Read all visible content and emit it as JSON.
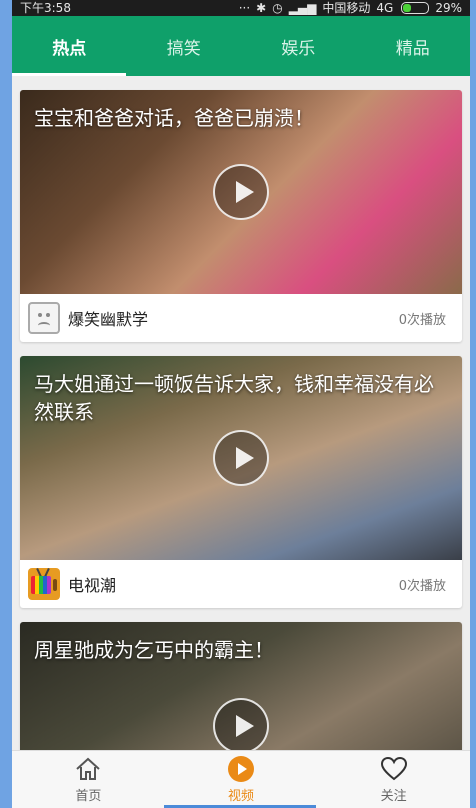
{
  "status": {
    "time": "下午3:58",
    "carrier": "中国移动",
    "network": "4G",
    "battery": "29%",
    "icons": [
      "dots-icon",
      "bluetooth-icon",
      "alarm-icon",
      "signal-icon",
      "battery-icon"
    ]
  },
  "tabs": [
    {
      "label": "热点",
      "active": true
    },
    {
      "label": "搞笑",
      "active": false
    },
    {
      "label": "娱乐",
      "active": false
    },
    {
      "label": "精品",
      "active": false
    }
  ],
  "cards": [
    {
      "title": "宝宝和爸爸对话，爸爸已崩溃！",
      "author": "爆笑幽默学",
      "plays": "0次播放",
      "avatar": "sad-face-icon"
    },
    {
      "title": "马大姐通过一顿饭告诉大家，钱和幸福没有必然联系",
      "author": "电视潮",
      "plays": "0次播放",
      "avatar": "tv-icon"
    },
    {
      "title": "周星驰成为乞丐中的霸主！",
      "author": "",
      "plays": "",
      "avatar": ""
    }
  ],
  "bottom_nav": [
    {
      "label": "首页",
      "icon": "home-icon",
      "active": false
    },
    {
      "label": "视频",
      "icon": "play-circle-icon",
      "active": true
    },
    {
      "label": "关注",
      "icon": "heart-icon",
      "active": false
    }
  ],
  "colors": {
    "tab_bar": "#0fa06a",
    "accent": "#ea8a16",
    "outer_bg": "#6fa3e3"
  }
}
